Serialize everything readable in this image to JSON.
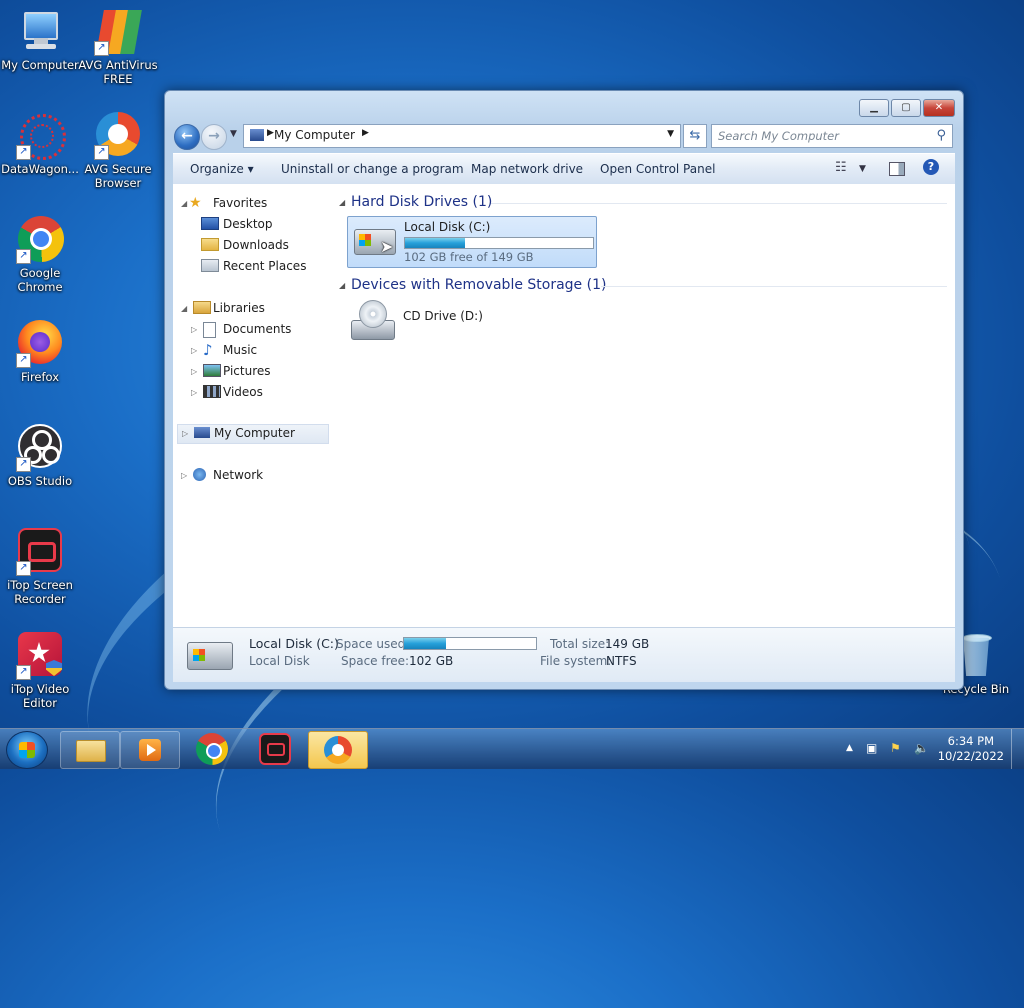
{
  "desktop": {
    "icons": [
      {
        "label": "My Computer"
      },
      {
        "label": "AVG AntiVirus FREE"
      },
      {
        "label": "DataWagon..."
      },
      {
        "label": "AVG Secure Browser"
      },
      {
        "label": "Google Chrome"
      },
      {
        "label": "Firefox"
      },
      {
        "label": "OBS Studio"
      },
      {
        "label": "iTop Screen Recorder"
      },
      {
        "label": "iTop Video Editor"
      },
      {
        "label": "Recycle Bin"
      }
    ]
  },
  "window": {
    "address": {
      "location": "My Computer"
    },
    "search": {
      "placeholder": "Search My Computer"
    },
    "toolbar": {
      "organize": "Organize",
      "uninstall": "Uninstall or change a program",
      "map_drive": "Map network drive",
      "control_panel": "Open Control Panel"
    },
    "nav": {
      "favorites": "Favorites",
      "desktop": "Desktop",
      "downloads": "Downloads",
      "recent": "Recent Places",
      "libraries": "Libraries",
      "documents": "Documents",
      "music": "Music",
      "pictures": "Pictures",
      "videos": "Videos",
      "computer": "My Computer",
      "network": "Network"
    },
    "content": {
      "group_hdd": "Hard Disk Drives (1)",
      "group_removable": "Devices with Removable Storage (1)",
      "drive_c": {
        "name": "Local Disk (C:)",
        "free_text": "102 GB free of 149 GB",
        "used_fraction": 0.32
      },
      "drive_d": {
        "name": "CD Drive (D:)"
      }
    },
    "details": {
      "name": "Local Disk (C:)",
      "type": "Local Disk",
      "space_used_label": "Space used:",
      "space_free_label": "Space free:",
      "space_free": "102 GB",
      "total_size_label": "Total size:",
      "total_size": "149 GB",
      "file_system_label": "File system:",
      "file_system": "NTFS"
    }
  },
  "taskbar": {
    "time": "6:34 PM",
    "date": "10/22/2022"
  },
  "colors": {
    "accent": "#26a0da",
    "selection": "#c1dcfa",
    "group_header": "#1e3287"
  }
}
